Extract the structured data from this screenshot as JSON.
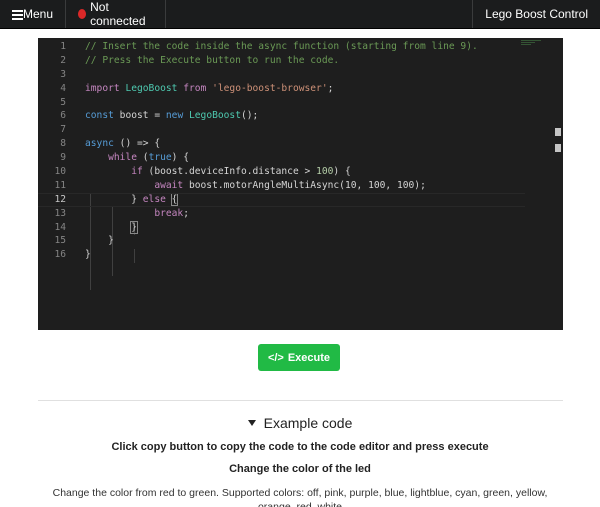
{
  "navbar": {
    "menu_label": "Menu",
    "status_label": "Not connected",
    "app_title": "Lego Boost Control",
    "status_color": "#db2828"
  },
  "editor": {
    "line_numbers": [
      "1",
      "2",
      "3",
      "4",
      "5",
      "6",
      "7",
      "8",
      "9",
      "10",
      "11",
      "12",
      "13",
      "14",
      "15",
      "16"
    ],
    "active_line": 12,
    "lines": {
      "l1": "// Insert the code inside the async function (starting from line 9).",
      "l2": "// Press the Execute button to run the code.",
      "l4_kw1": "import",
      "l4_cls": "LegoBoost",
      "l4_kw2": "from",
      "l4_str": "'lego-boost-browser'",
      "l4_end": ";",
      "l6_kw": "const",
      "l6_var": "boost = ",
      "l6_new": "new",
      "l6_cls": "LegoBoost",
      "l6_end": "();",
      "l8_kw": "async",
      "l8_rest": " () => {",
      "l9_kw": "while",
      "l9_open": " (",
      "l9_true": "true",
      "l9_close": ") {",
      "l10_kw": "if",
      "l10_mid": " (boost.deviceInfo.distance > ",
      "l10_num": "100",
      "l10_end": ") {",
      "l11_kw": "await",
      "l11_obj": " boost.",
      "l11_fn": "motorAngleMultiAsync",
      "l11_open": "(",
      "l11_n1": "10",
      "l11_sep1": ", ",
      "l11_n2": "100",
      "l11_sep2": ", ",
      "l11_n3": "100",
      "l11_end": ");",
      "l12_close": "} ",
      "l12_kw": "else",
      "l12_open": "{",
      "l13_kw": "break",
      "l13_end": ";",
      "l14": "}",
      "l15": "}",
      "l16": "}"
    }
  },
  "execute_button": {
    "icon": "code-icon",
    "label": "Execute",
    "color": "#21ba45"
  },
  "example": {
    "header": "Example code",
    "instruction": "Click copy button to copy the code to the code editor and press execute",
    "subtitle": "Change the color of the led",
    "description": "Change the color from red to green. Supported colors: off, pink, purple, blue, lightblue, cyan, green, yellow, orange, red, white"
  }
}
